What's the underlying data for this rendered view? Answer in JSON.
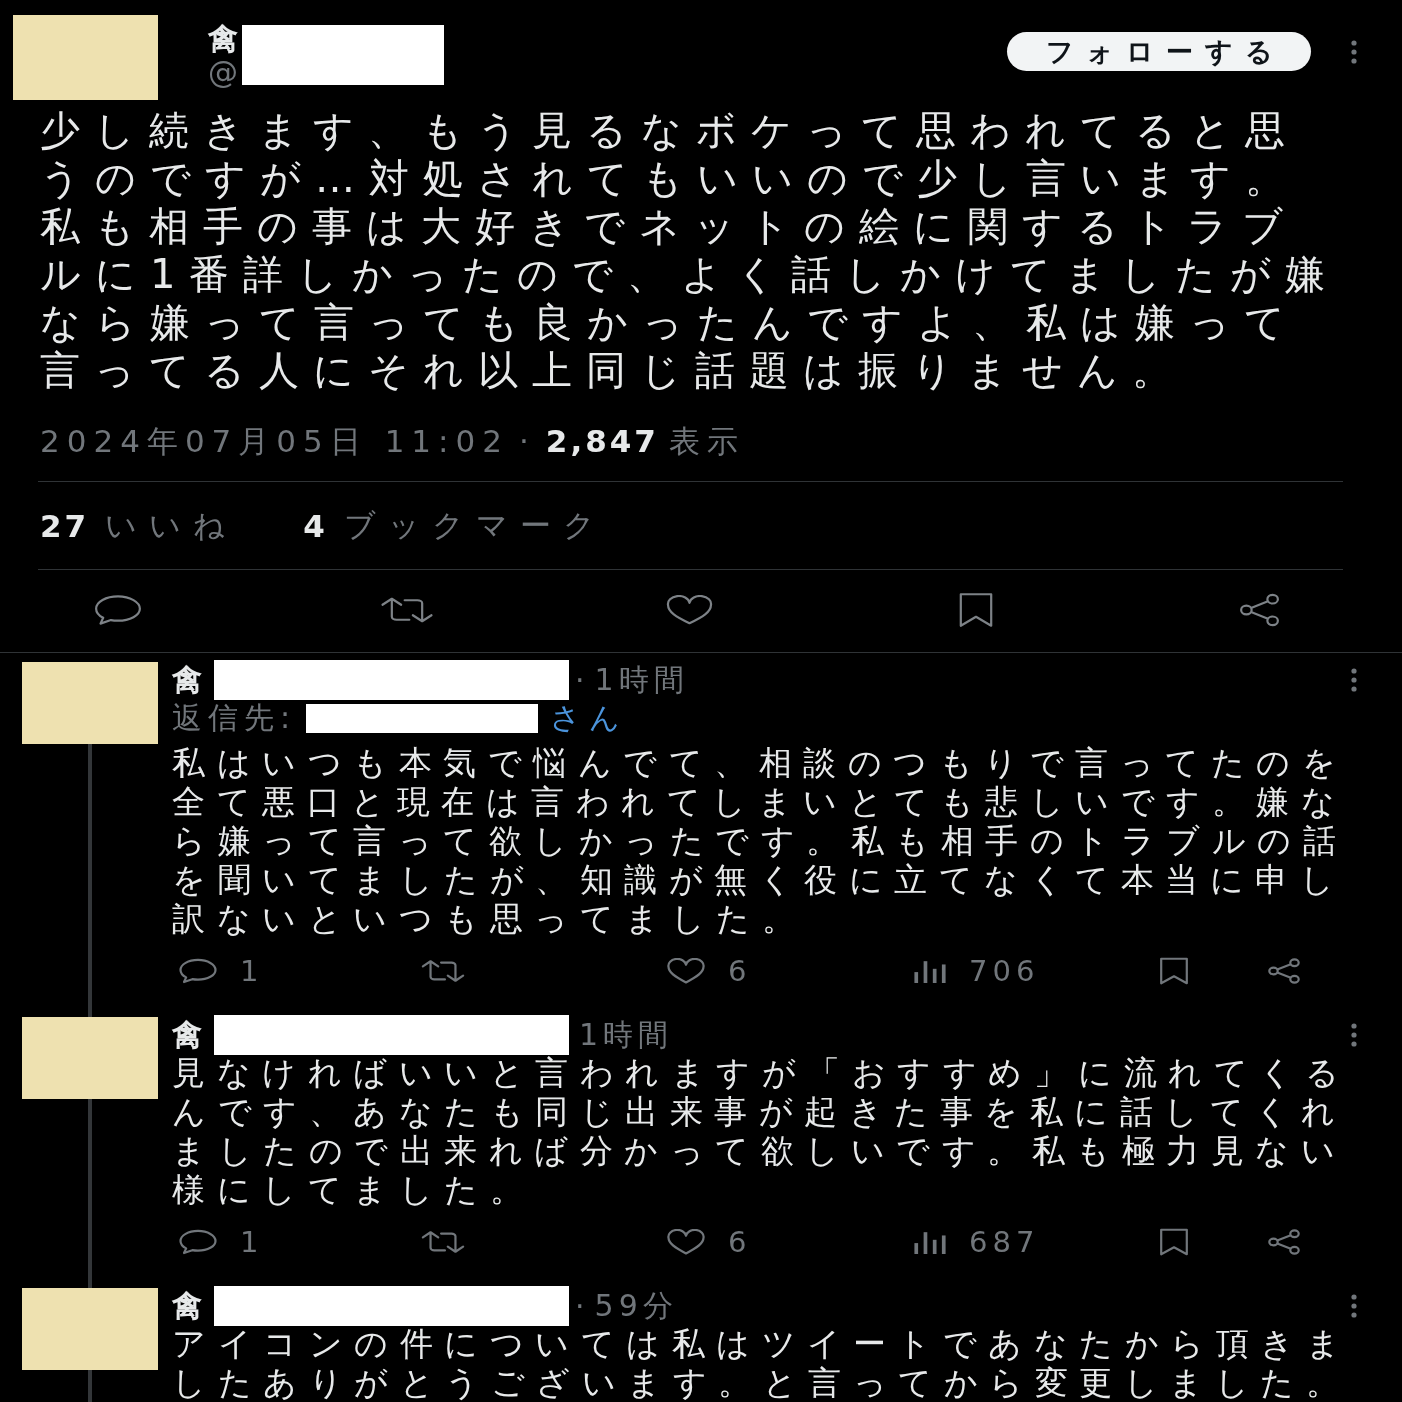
{
  "post": {
    "author": {
      "name": "禽",
      "handle": "@",
      "redacted": true
    },
    "follow_button": "フォローする",
    "text": "少し続きます、もう見るなボケって思われてると思うのですが…対処されてもいいので少し言います。私も相手の事は大好きでネットの絵に関するトラブルに1番詳しかったので、よく話しかけてましたが嫌なら嫌って言っても良かったんですよ、私は嫌って言ってる人にそれ以上同じ話題は振りません。",
    "timestamp": "2024年07月05日 11:02",
    "separator": "·",
    "views": "2,847",
    "views_label": "表示",
    "stats": [
      {
        "count": "27",
        "label": "いいね"
      },
      {
        "count": "4",
        "label": "ブックマーク"
      }
    ]
  },
  "replies": [
    {
      "author": {
        "name": "禽",
        "redacted": true
      },
      "separator": "·",
      "time": "1時間",
      "reply_to": {
        "label": "返信先:",
        "suffix": "さん",
        "redacted": true
      },
      "text": "私はいつも本気で悩んでて、相談のつもりで言ってたのを全て悪口と現在は言われてしまいとても悲しいです。嫌なら嫌って言って欲しかったです。私も相手のトラブルの話を聞いてましたが、知識が無く役に立てなくて本当に申し訳ないといつも思ってました。",
      "metrics": {
        "replies": "1",
        "likes": "6",
        "views": "706"
      }
    },
    {
      "author": {
        "name": "禽",
        "redacted": true
      },
      "time": "1時間",
      "text": "見なければいいと言われますが「おすすめ」に流れてくるんです、あなたも同じ出来事が起きた事を私に話してくれましたので出来れば分かって欲しいです。私も極力見ない様にしてました。",
      "metrics": {
        "replies": "1",
        "likes": "6",
        "views": "687"
      }
    },
    {
      "author": {
        "name": "禽",
        "redacted": true
      },
      "separator": "·",
      "time": "59分",
      "text": "アイコンの件については私はツイートであなたから頂きましたありがとうございます。と言ってから変更しました。"
    }
  ]
}
